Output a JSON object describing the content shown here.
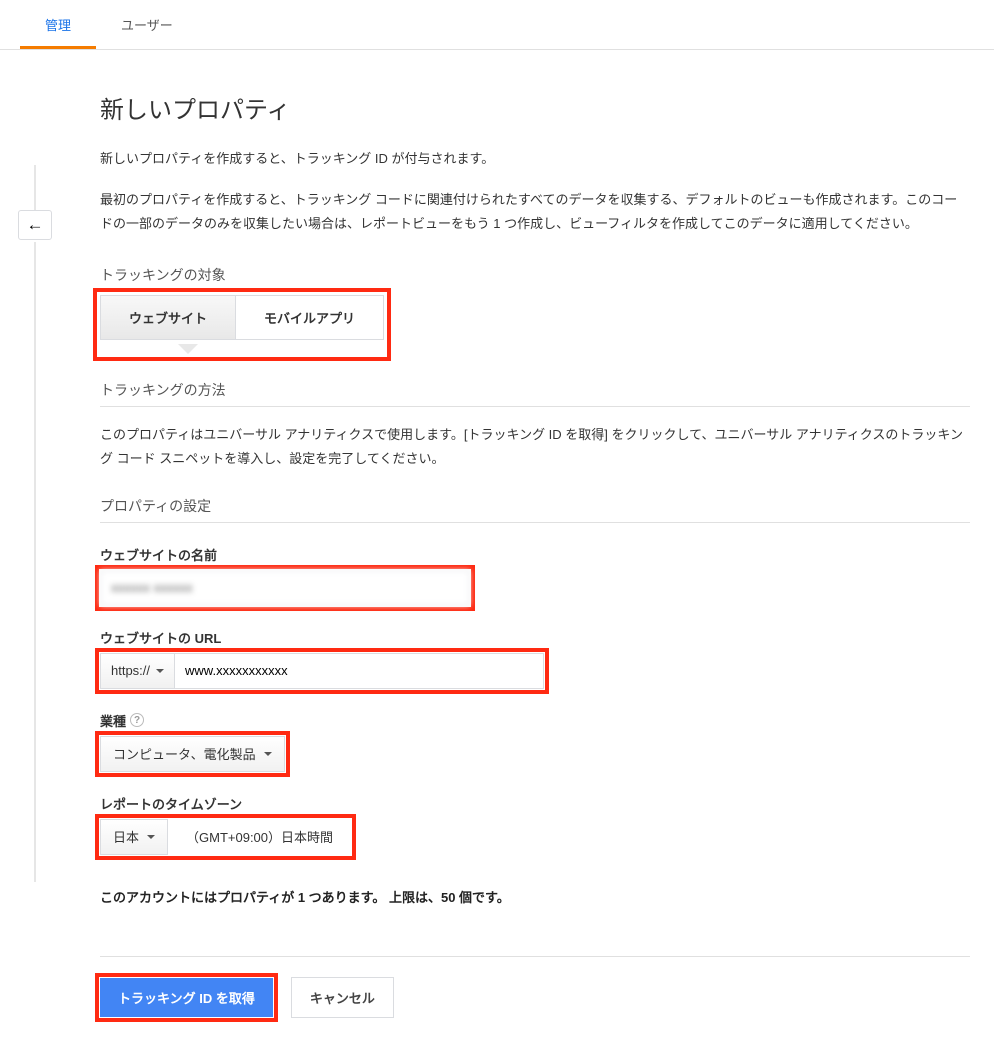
{
  "tabs": {
    "admin": "管理",
    "user": "ユーザー"
  },
  "page": {
    "title": "新しいプロパティ",
    "desc1": "新しいプロパティを作成すると、トラッキング ID が付与されます。",
    "desc2": "最初のプロパティを作成すると、トラッキング コードに関連付けられたすべてのデータを収集する、デフォルトのビューも作成されます。このコードの一部のデータのみを収集したい場合は、レポートビューをもう 1 つ作成し、ビューフィルタを作成してこのデータに適用してください。"
  },
  "tracking_target": {
    "label": "トラッキングの対象",
    "website": "ウェブサイト",
    "mobile": "モバイルアプリ"
  },
  "tracking_method": {
    "header": "トラッキングの方法",
    "desc": "このプロパティはユニバーサル アナリティクスで使用します。[トラッキング ID を取得] をクリックして、ユニバーサル アナリティクスのトラッキング コード スニペットを導入し、設定を完了してください。"
  },
  "property_settings": {
    "header": "プロパティの設定",
    "site_name_label": "ウェブサイトの名前",
    "site_name_value": "xxxxxx xxxxxx",
    "url_label": "ウェブサイトの URL",
    "protocol": "https://",
    "url_value": "www.xxxxxxxxxxx",
    "industry_label": "業種",
    "industry_value": "コンピュータ、電化製品",
    "timezone_label": "レポートのタイムゾーン",
    "tz_country": "日本",
    "tz_value": "（GMT+09:00）日本時間"
  },
  "account_note": "このアカウントにはプロパティが 1 つあります。 上限は、50 個です。",
  "buttons": {
    "get_id": "トラッキング ID を取得",
    "cancel": "キャンセル"
  },
  "help_icon": "?"
}
